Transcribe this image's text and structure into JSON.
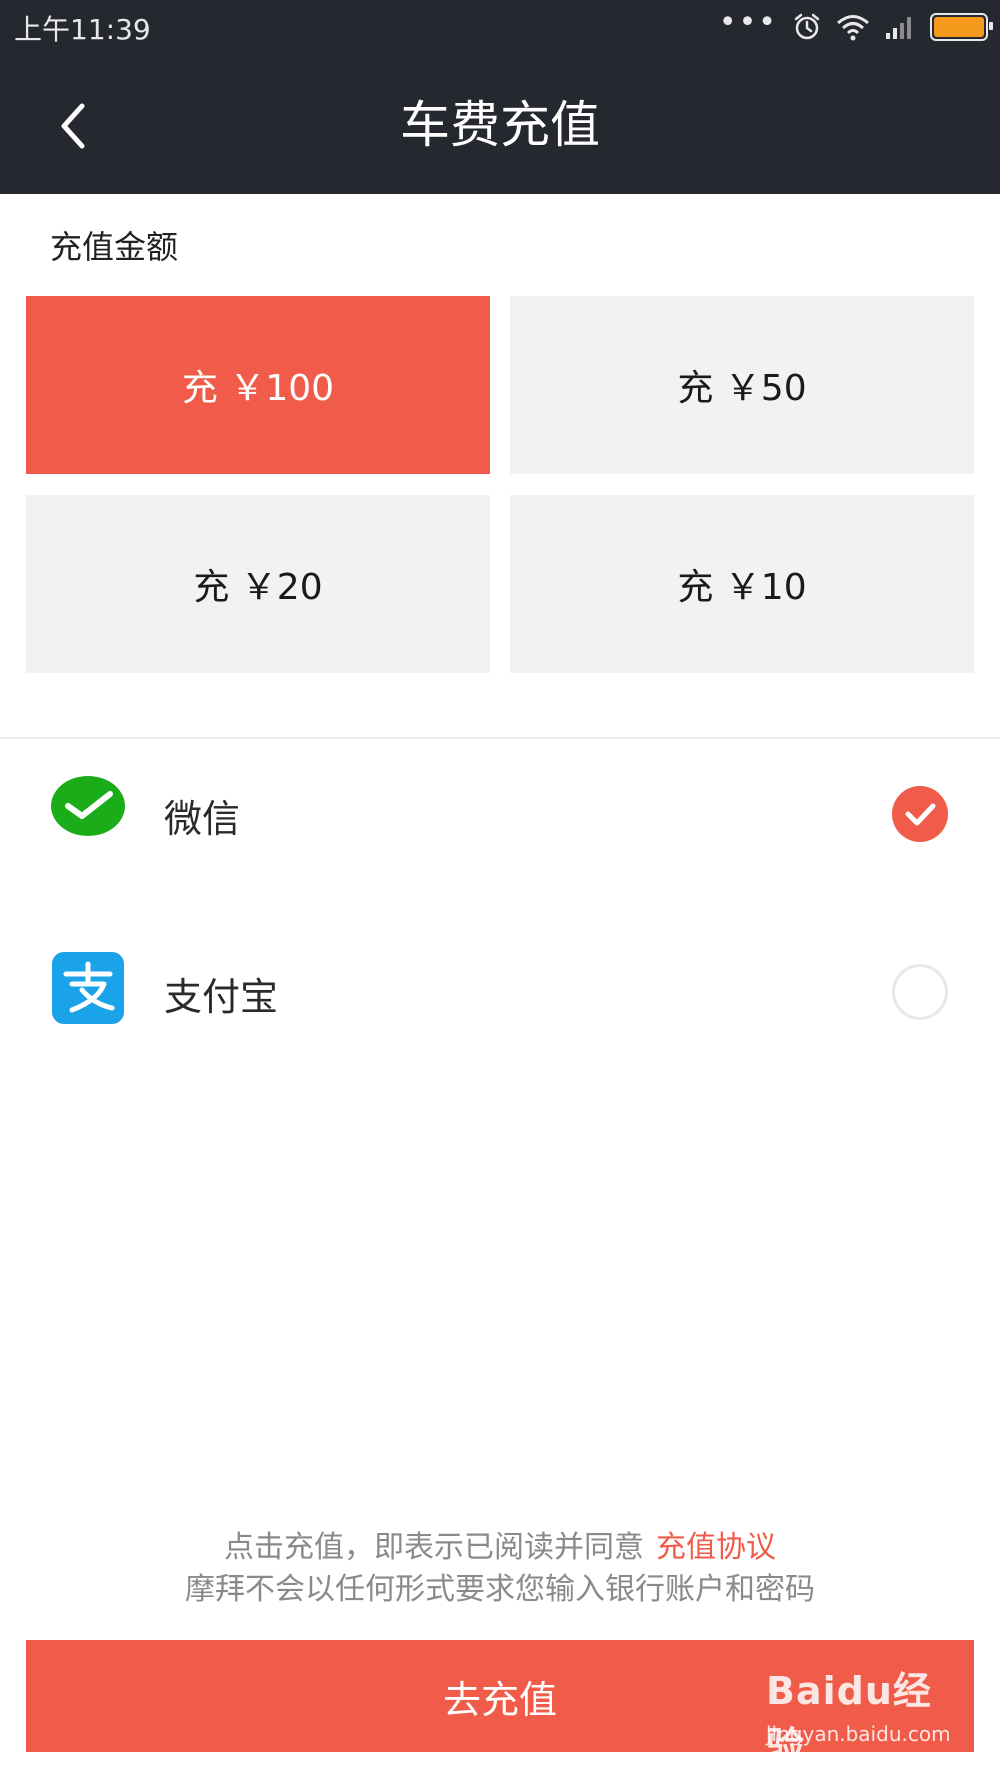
{
  "status_bar": {
    "time": "上午11:39",
    "icons": [
      "more-dots-icon",
      "alarm-icon",
      "wifi-icon",
      "signal-icon",
      "battery-icon"
    ]
  },
  "nav": {
    "title": "车费充值",
    "back_icon": "chevron-left-icon"
  },
  "recharge": {
    "section_title": "充值金额",
    "options": [
      {
        "label": "充 ￥100",
        "selected": true
      },
      {
        "label": "充 ￥50",
        "selected": false
      },
      {
        "label": "充 ￥20",
        "selected": false
      },
      {
        "label": "充 ￥10",
        "selected": false
      }
    ]
  },
  "payment_methods": [
    {
      "label": "微信",
      "icon": "wechat-icon",
      "checked": true
    },
    {
      "label": "支付宝",
      "icon": "alipay-icon",
      "checked": false
    }
  ],
  "notice": {
    "line1": "点击充值，即表示已阅读并同意",
    "agreement_link": "充值协议",
    "line2": "摩拜不会以任何形式要求您输入银行账户和密码"
  },
  "submit_label": "去充值",
  "watermark": {
    "logo_text": "Baidu经验",
    "url": "jingyan.baidu.com"
  },
  "colors": {
    "accent": "#f05c49",
    "header_bg": "#262830",
    "option_bg": "#f2f2f2",
    "wechat_green": "#1aad19",
    "alipay_blue": "#1aa3e8",
    "battery": "#f59a1d"
  }
}
